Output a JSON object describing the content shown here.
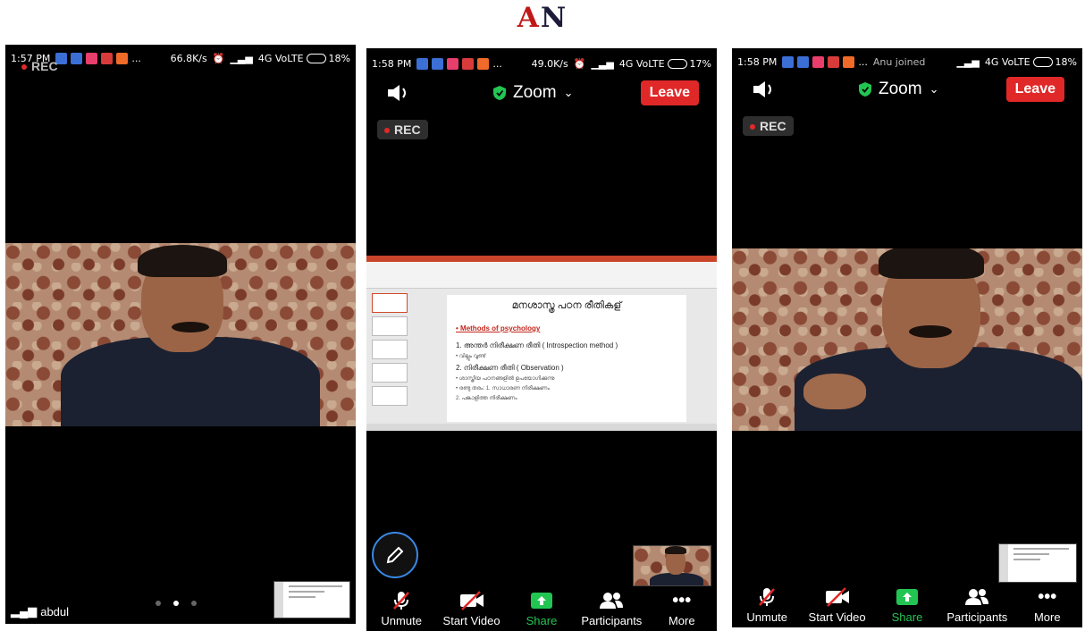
{
  "logo": {
    "a": "A",
    "n": "N"
  },
  "left_panel": {
    "status": {
      "time": "1:57 PM",
      "speed": "66.8K/s",
      "network": "4G VoLTE",
      "battery": "18%"
    },
    "rec_label": "REC",
    "participant_name": "abdul"
  },
  "middle_panel": {
    "status": {
      "time": "1:58 PM",
      "speed": "49.0K/s",
      "network": "4G VoLTE",
      "battery": "17%"
    },
    "meeting_title": "Zoom",
    "leave_label": "Leave",
    "rec_label": "REC",
    "slide": {
      "title": "മനശാസ്ത്ര പഠന രീതികള്",
      "heading": "Methods of psychology",
      "items": [
        "1.  അന്തർ നിരീക്ഷണ രീതി  ( Introspection method )",
        "•  വില്ലും വൂണ്ട്",
        "2. നിരീക്ഷണ രീതി ( Observation )",
        "•  ശാസ്ത്രീയ പഠനങ്ങളിൽ ഉപയോഗിക്കുന്നു",
        "•  രണ്ടു തരം: 1. സാധാരണ നിരീക്ഷണം",
        "      2. പങ്കാളിത്ത നിരീക്ഷണം"
      ]
    },
    "toolbar": {
      "unmute": "Unmute",
      "start_video": "Start Video",
      "share": "Share",
      "participants": "Participants",
      "more": "More"
    }
  },
  "right_panel": {
    "status": {
      "time": "1:58 PM",
      "joined": "Anu joined",
      "network": "4G VoLTE",
      "battery": "18%"
    },
    "meeting_title": "Zoom",
    "leave_label": "Leave",
    "rec_label": "REC",
    "toolbar": {
      "unmute": "Unmute",
      "start_video": "Start Video",
      "share": "Share",
      "participants": "Participants",
      "more": "More"
    }
  },
  "colors": {
    "leave": "#e02828",
    "share": "#23c552",
    "rec_dot": "#e02a2a",
    "logo_a": "#c01818",
    "logo_n": "#1c1c3a"
  }
}
